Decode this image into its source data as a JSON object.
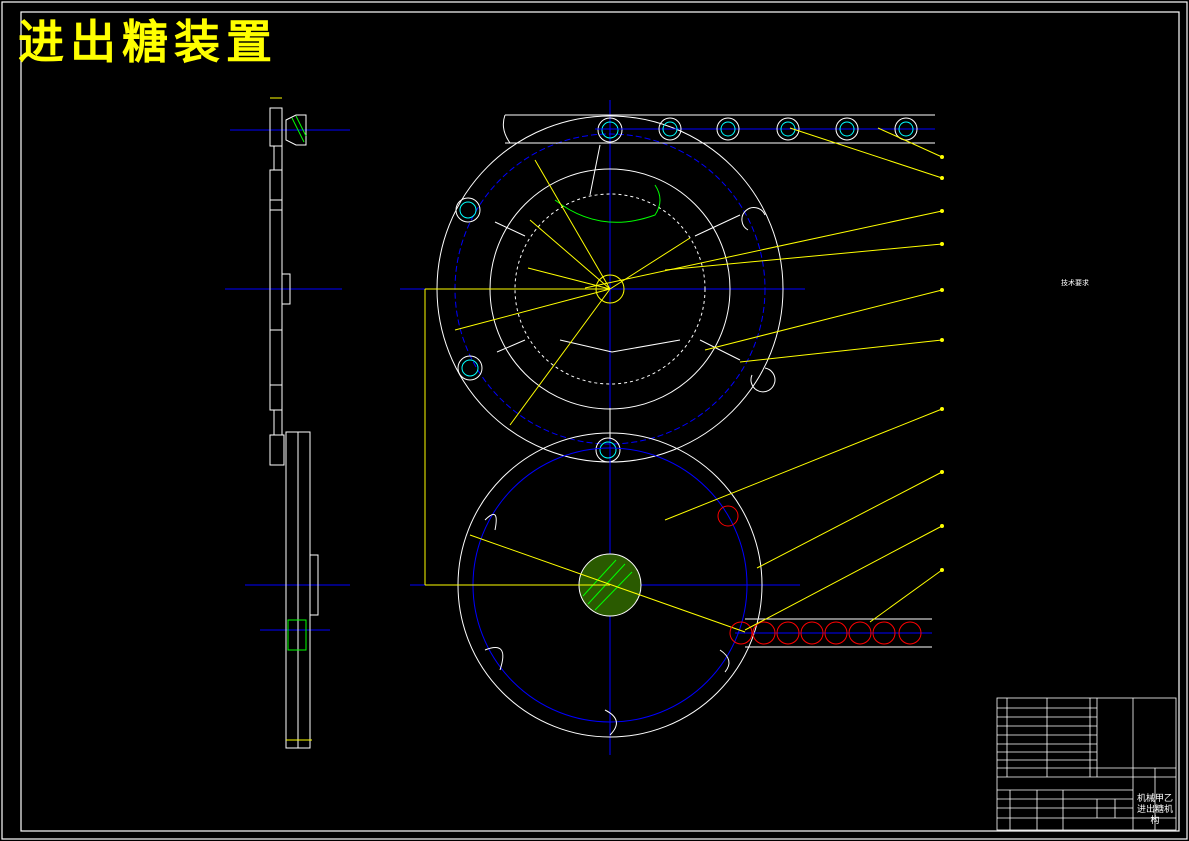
{
  "drawing": {
    "title": "进出糖装置",
    "notes_heading": "技术要求",
    "notes_lines": [
      "",
      ""
    ]
  },
  "title_block": {
    "designation_line1": "机械甲乙",
    "designation_line2": "进出糖机构"
  },
  "colors": {
    "background": "#000000",
    "outline": "#ffffff",
    "center_lines": "#0000ff",
    "leaders": "#ffff00",
    "section_hatch": "#00ff00",
    "candy": "#ff0000",
    "pockets": "#00ffff"
  }
}
